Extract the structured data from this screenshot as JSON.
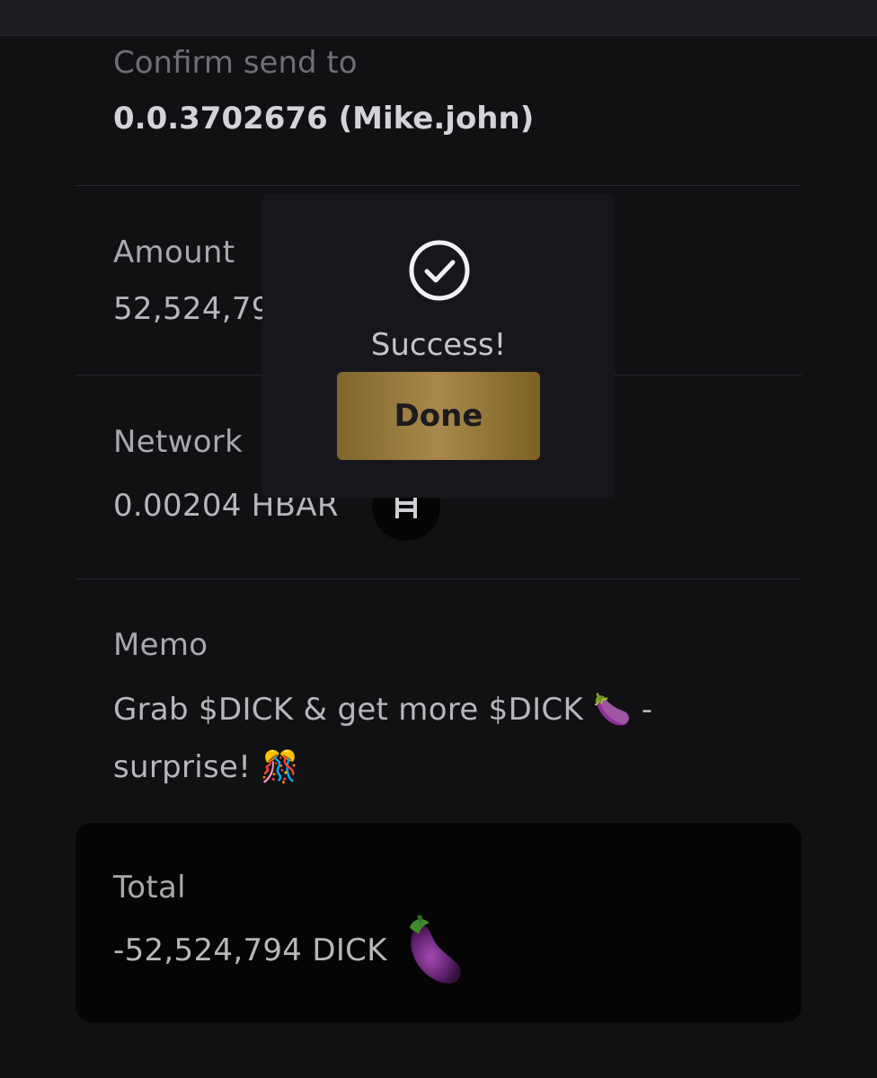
{
  "confirm": {
    "label": "Confirm send to",
    "recipient": "0.0.3702676 (Mike.john)"
  },
  "amount": {
    "label": "Amount",
    "value": "52,524,794"
  },
  "network": {
    "label": "Network",
    "fee": "0.00204 HBAR",
    "icon": "hbar-icon"
  },
  "memo": {
    "label": "Memo",
    "line1": "Grab $DICK & get more $DICK 🍆 -",
    "line2": "surprise! 🎊"
  },
  "total": {
    "label": "Total",
    "value": "-52,524,794 DICK",
    "icon": "eggplant-icon"
  },
  "modal": {
    "icon": "check-circle-icon",
    "message": "Success!",
    "button_label": "Done"
  },
  "colors": {
    "background": "#111113",
    "card": "#050506",
    "modal": "#17171b",
    "gold": "#a8894b"
  }
}
